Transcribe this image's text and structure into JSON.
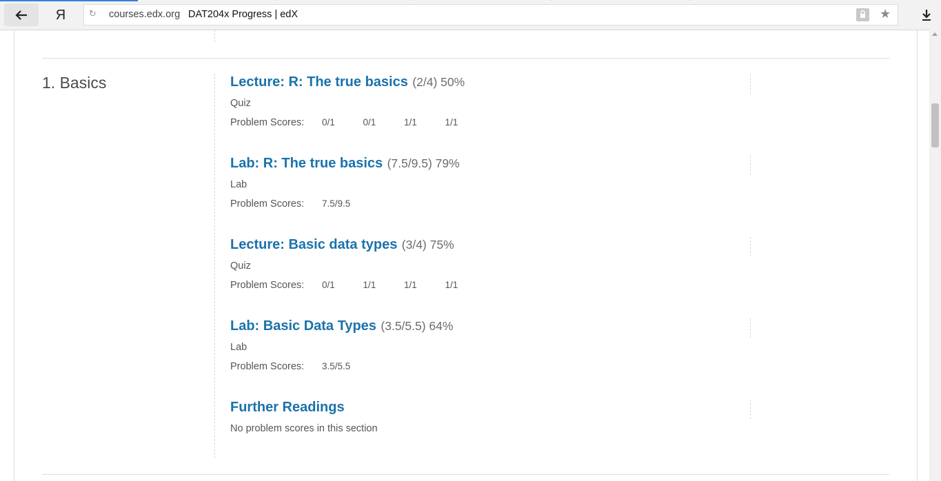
{
  "browser": {
    "yandex_glyph": "Я",
    "domain": "courses.edx.org",
    "title": "DAT204x Progress | edX",
    "icons": [
      "back-arrow-icon",
      "yandex-icon",
      "reload-icon",
      "lock-icon",
      "star-icon",
      "download-icon"
    ]
  },
  "section": {
    "title": "1. Basics",
    "scores_label": "Problem Scores:",
    "subsections": [
      {
        "name": "Lecture: R: The true basics",
        "score": "(2/4) 50%",
        "type": "Quiz",
        "scores": [
          "0/1",
          "0/1",
          "1/1",
          "1/1"
        ]
      },
      {
        "name": "Lab: R: The true basics",
        "score": "(7.5/9.5) 79%",
        "type": "Lab",
        "scores": [
          "7.5/9.5"
        ]
      },
      {
        "name": "Lecture: Basic data types",
        "score": "(3/4) 75%",
        "type": "Quiz",
        "scores": [
          "0/1",
          "1/1",
          "1/1",
          "1/1"
        ]
      },
      {
        "name": "Lab: Basic Data Types",
        "score": "(3.5/5.5) 64%",
        "type": "Lab",
        "scores": [
          "3.5/5.5"
        ]
      },
      {
        "name": "Further Readings",
        "score": "",
        "type": "",
        "no_scores_text": "No problem scores in this section"
      }
    ]
  },
  "colors": {
    "link": "#1a72ab",
    "text": "#555555",
    "score_muted": "#6d6d6d"
  }
}
